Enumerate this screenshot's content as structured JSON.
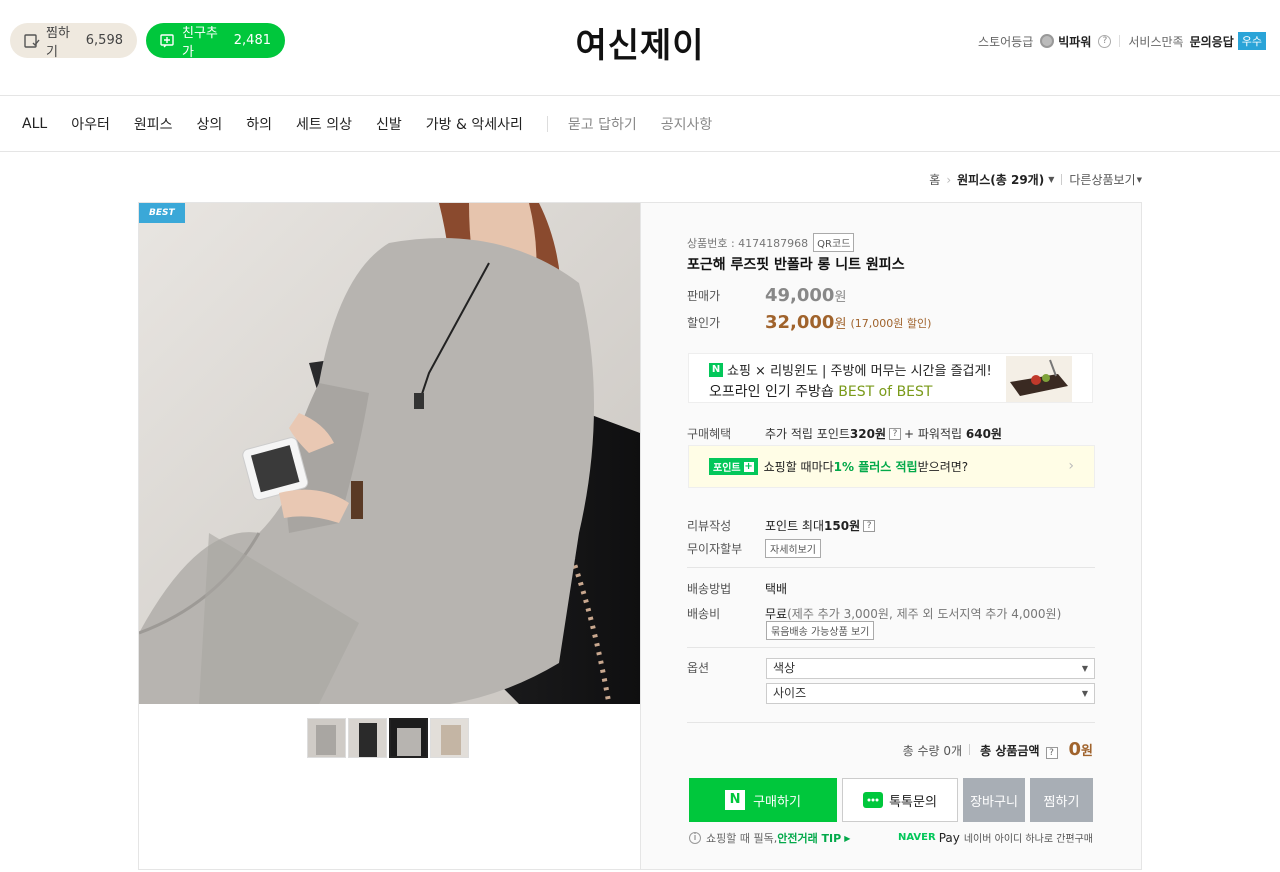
{
  "header": {
    "zzim_label": "찜하기",
    "zzim_count": "6,598",
    "friend_label": "친구추가",
    "friend_count": "2,481",
    "store_name": "여신제이",
    "store_grade_label": "스토어등급",
    "store_grade_value": "빅파워",
    "service_label": "서비스만족",
    "service_value": "문의응답",
    "service_badge": "우수"
  },
  "nav": {
    "items": [
      "ALL",
      "아우터",
      "원피스",
      "상의",
      "하의",
      "세트 의상",
      "신발",
      "가방 & 악세사리"
    ],
    "extra": [
      "묻고 답하기",
      "공지사항"
    ]
  },
  "breadcrumb": {
    "home": "홈",
    "category": "원피스",
    "count": "(총 29개)",
    "other": "다른상품보기"
  },
  "product": {
    "best_badge": "BEST",
    "number_label": "상품번호 : 4174187968",
    "qr_label": "QR코드",
    "name": "포근해 루즈핏 반폴라 롱 니트 원피스",
    "price_label": "판매가",
    "price": "49,000",
    "price_unit": "원",
    "sale_label": "할인가",
    "sale_price": "32,000",
    "sale_unit": "원",
    "discount": "(17,000원 할인)",
    "banner_line1": "쇼핑 × 리빙윈도 | 주방에 머무는 시간을 즐겁게!",
    "banner_line2_a": "오프라인 인기 주방숍 ",
    "banner_line2_b": "BEST of BEST",
    "benefit_label": "구매혜택",
    "benefit_a": "추가 적립 포인트 ",
    "benefit_a_val": "320원",
    "benefit_b": " + 파워적립 ",
    "benefit_b_val": "640원",
    "point_badge": "포인트",
    "point_text_a": "쇼핑할 때마다 ",
    "point_text_b": "1% 플러스 적립",
    "point_text_c": " 받으려면?",
    "review_label": "리뷰작성",
    "review_value_a": "포인트 최대 ",
    "review_value_b": "150원",
    "installment_label": "무이자할부",
    "installment_btn": "자세히보기",
    "ship_label": "배송방법",
    "ship_value": "택배",
    "fee_label": "배송비",
    "fee_value_a": "무료",
    "fee_value_b": " (제주 추가 3,000원, 제주 외 도서지역 추가 4,000원)",
    "bundle_btn": "묶음배송 가능상품 보기",
    "option_label": "옵션",
    "option1": "색상",
    "option2": "사이즈",
    "qty_label": "총 수량",
    "qty_value": "0개",
    "total_label": "총 상품금액",
    "total_value": "0",
    "total_unit": "원",
    "buy_btn": "구매하기",
    "talk_btn": "톡톡문의",
    "cart_btn": "장바구니",
    "zzim_btn": "찜하기",
    "tip_a": "쇼핑할 때 필독, ",
    "tip_b": "안전거래 TIP",
    "npay_brand": "NAVER",
    "npay_pay": "Pay",
    "npay_text": "네이버 아이디 하나로 간편구매"
  },
  "colors": {
    "green": "#00c73c",
    "price_brown": "#a0632c",
    "badge_blue": "#2aa4d8"
  }
}
